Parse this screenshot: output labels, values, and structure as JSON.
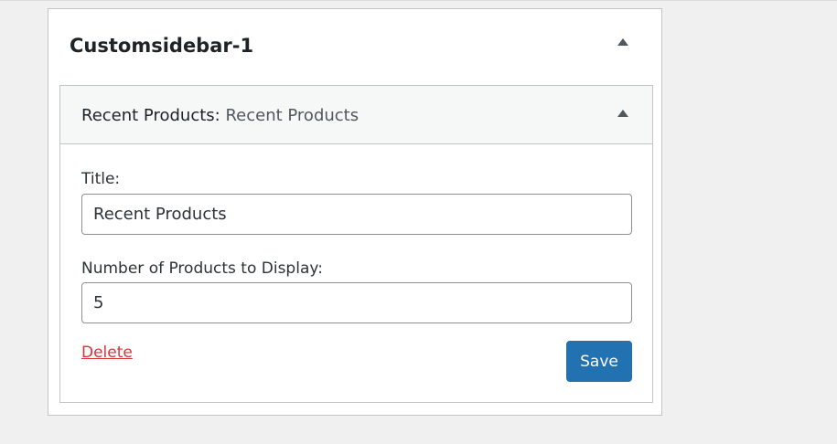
{
  "sidebar": {
    "title": "Customsidebar-1",
    "toggle_icon": "arrow-up-icon"
  },
  "widget": {
    "name": "Recent Products:",
    "subtitle": "Recent Products",
    "toggle_icon": "arrow-up-icon",
    "fields": {
      "title_label": "Title:",
      "title_value": "Recent Products",
      "count_label": "Number of Products to Display:",
      "count_value": "5"
    },
    "delete_label": "Delete",
    "save_label": "Save"
  },
  "colors": {
    "background": "#f0f0f1",
    "panel": "#ffffff",
    "widget_header": "#f6f7f7",
    "delete": "#d63638",
    "save": "#2271b1"
  }
}
